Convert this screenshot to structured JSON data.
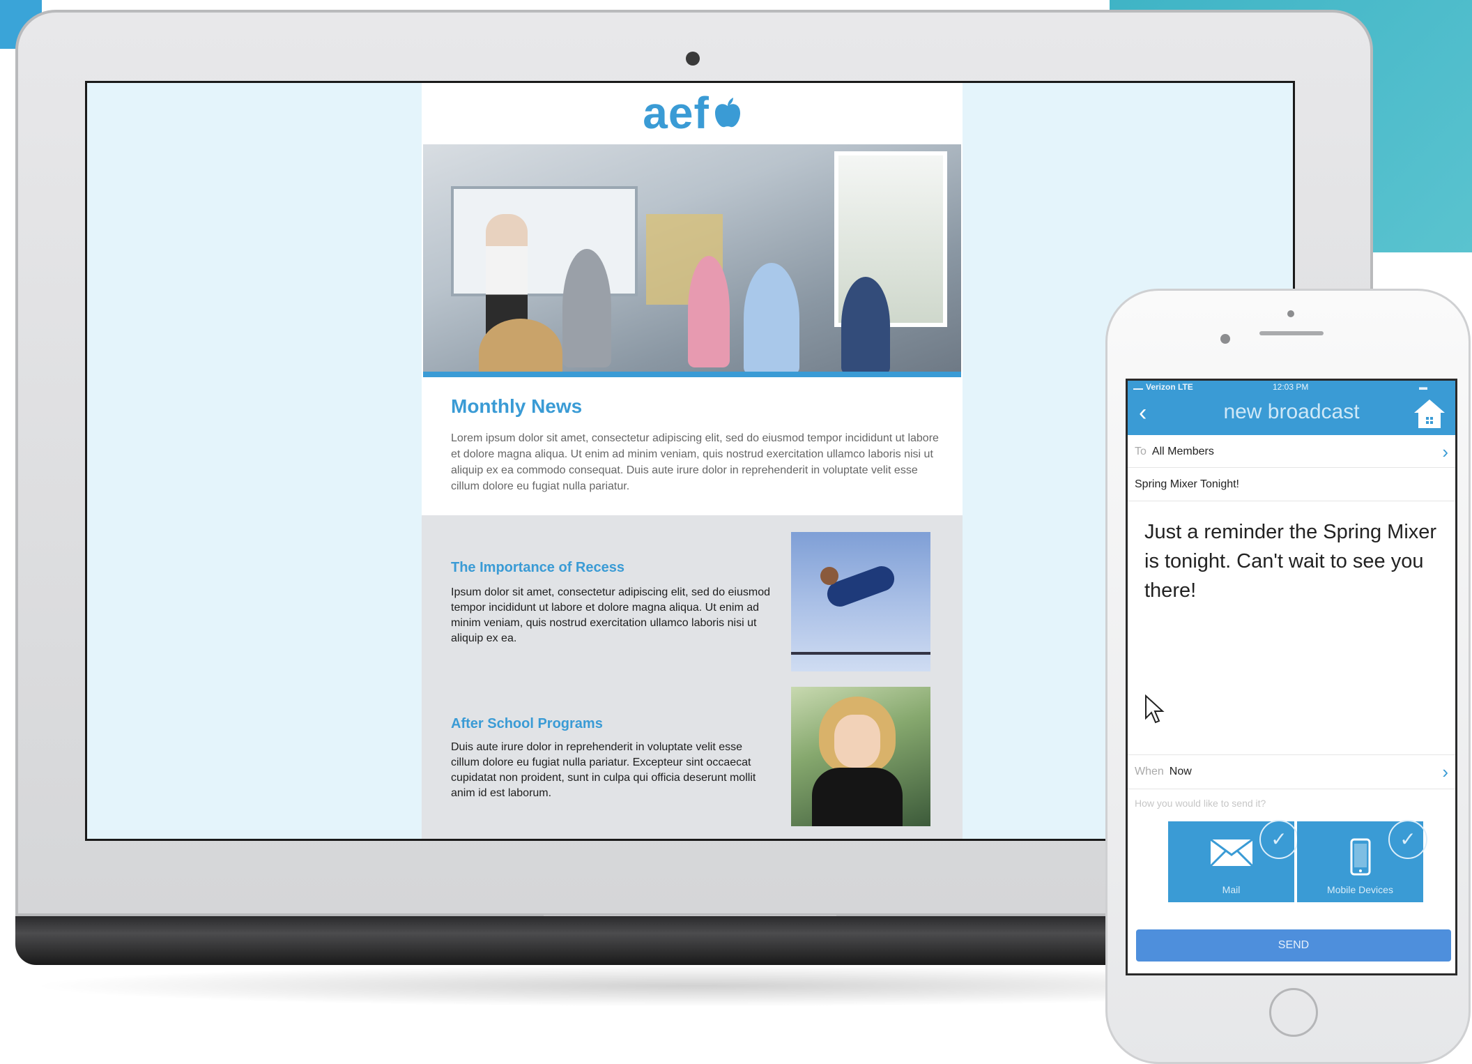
{
  "newsletter": {
    "logo_text": "aef",
    "monthly_title": "Monthly News",
    "monthly_body": "Lorem ipsum dolor sit amet, consectetur adipiscing elit, sed do eiusmod tempor incididunt ut labore et dolore magna aliqua. Ut enim ad minim veniam, quis nostrud exercitation ullamco laboris nisi ut aliquip ex ea commodo consequat. Duis aute irure dolor in reprehenderit in voluptate velit esse cillum dolore eu fugiat nulla pariatur.",
    "articles": [
      {
        "title": "The Importance of Recess",
        "body": "Ipsum dolor sit amet, consectetur adipiscing elit, sed do eiusmod tempor incididunt ut labore et dolore magna aliqua. Ut enim ad minim veniam, quis nostrud exercitation ullamco laboris nisi ut aliquip ex ea."
      },
      {
        "title": "After School Programs",
        "body": "Duis aute irure dolor in reprehenderit in voluptate velit esse cillum dolore eu fugiat nulla pariatur. Excepteur sint occaecat cupidatat non proident, sunt in culpa qui officia deserunt mollit anim id est laborum."
      }
    ]
  },
  "phone": {
    "status": {
      "carrier": "Verizon",
      "network": "LTE",
      "time": "12:03 PM"
    },
    "header_title": "new broadcast",
    "to_label": "To",
    "to_value": "All Members",
    "subject": "Spring Mixer Tonight!",
    "message": "Just a reminder the Spring Mixer is tonight. Can't wait to see you there!",
    "when_label": "When",
    "when_value": "Now",
    "how_prompt": "How you would like to send it?",
    "options": [
      {
        "label": "Mail",
        "icon": "mail-icon",
        "selected": true
      },
      {
        "label": "Mobile Devices",
        "icon": "mobile-device-icon",
        "selected": true
      }
    ],
    "send_label": "SEND"
  },
  "colors": {
    "brand_blue": "#3a9bd5",
    "send_blue": "#4e8fdc",
    "teal_panel": "#3fb4c6",
    "screen_bg": "#e4f4fb"
  }
}
